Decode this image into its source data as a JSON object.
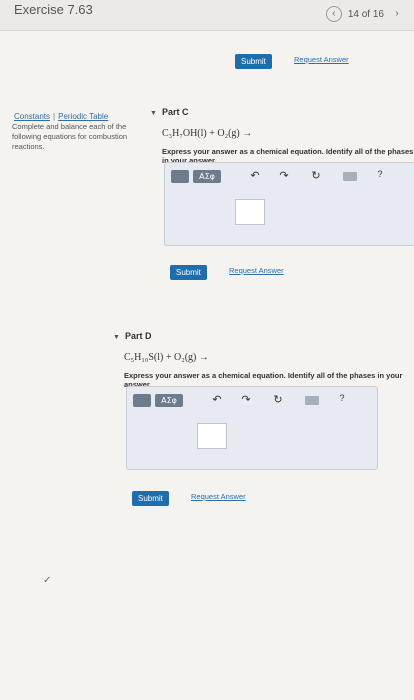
{
  "header": {
    "exercise_title": "Exercise 7.63",
    "pager_text": "14 of 16",
    "prev_icon": "chevron-left-icon",
    "next_icon": "chevron-right-icon"
  },
  "sidebar": {
    "constants_link": "Constants",
    "separator": "|",
    "periodic_table_link": "Periodic Table",
    "instructions": "Complete and balance each of the following equations for combustion reactions."
  },
  "top_actions": {
    "submit_label": "Submit",
    "request_answer_label": "Request Answer"
  },
  "parts": [
    {
      "title": "Part C",
      "equation": "C₃H₇OH(l) + O₂(g) →",
      "instruction": "Express your answer as a chemical equation. Identify all of the phases in your answer.",
      "toolbar": {
        "symbol_btn": "ΑΣφ",
        "help": "?"
      },
      "submit_label": "Submit",
      "request_answer_label": "Request Answer"
    },
    {
      "title": "Part D",
      "equation": "C₅H₁₀S(l) + O₂(g) →",
      "instruction": "Express your answer as a chemical equation. Identify all of the phases in your answer.",
      "toolbar": {
        "symbol_btn": "ΑΣφ",
        "help": "?"
      },
      "submit_label": "Submit",
      "request_answer_label": "Request Answer"
    }
  ],
  "colors": {
    "accent": "#1f6dad",
    "link": "#2d6ea8",
    "editor_bg": "#e7eaf0",
    "toolbar_btn": "#6d7b8e"
  }
}
